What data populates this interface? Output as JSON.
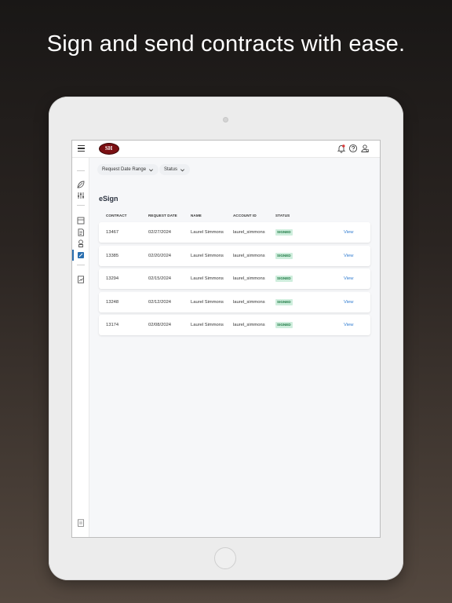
{
  "headline": "Sign and send contracts with ease.",
  "app": {
    "logo_text": "SH",
    "brand_color": "#7a0f12",
    "accent_color": "#2f7bd0",
    "notification_dot_color": "#d93a3a"
  },
  "topbar": {
    "icons": [
      "menu-icon",
      "bell-icon",
      "help-icon",
      "user-icon"
    ]
  },
  "sidebar": {
    "icons": [
      "leaf-icon",
      "sliders-icon",
      "inbox-icon",
      "document-icon",
      "badge-icon",
      "esign-icon",
      "report-icon",
      "logout-icon"
    ],
    "active": "esign-icon"
  },
  "filters": [
    {
      "label": "Request Date Range"
    },
    {
      "label": "Status"
    }
  ],
  "page_title": "eSign",
  "table": {
    "headers": [
      "CONTRACT",
      "REQUEST DATE",
      "NAME",
      "ACCOUNT ID",
      "STATUS"
    ],
    "rows": [
      {
        "contract": "13467",
        "date": "02/27/2024",
        "name": "Laurel Simmons",
        "account_id": "laurel_simmons",
        "status": "SIGNED",
        "action": "View"
      },
      {
        "contract": "13385",
        "date": "02/20/2024",
        "name": "Laurel Simmons",
        "account_id": "laurel_simmons",
        "status": "SIGNED",
        "action": "View"
      },
      {
        "contract": "13294",
        "date": "02/15/2024",
        "name": "Laurel Simmons",
        "account_id": "laurel_simmons",
        "status": "SIGNED",
        "action": "View"
      },
      {
        "contract": "13248",
        "date": "02/12/2024",
        "name": "Laurel Simmons",
        "account_id": "laurel_simmons",
        "status": "SIGNED",
        "action": "View"
      },
      {
        "contract": "13174",
        "date": "02/08/2024",
        "name": "Laurel Simmons",
        "account_id": "laurel_simmons",
        "status": "SIGNED",
        "action": "View"
      }
    ]
  }
}
